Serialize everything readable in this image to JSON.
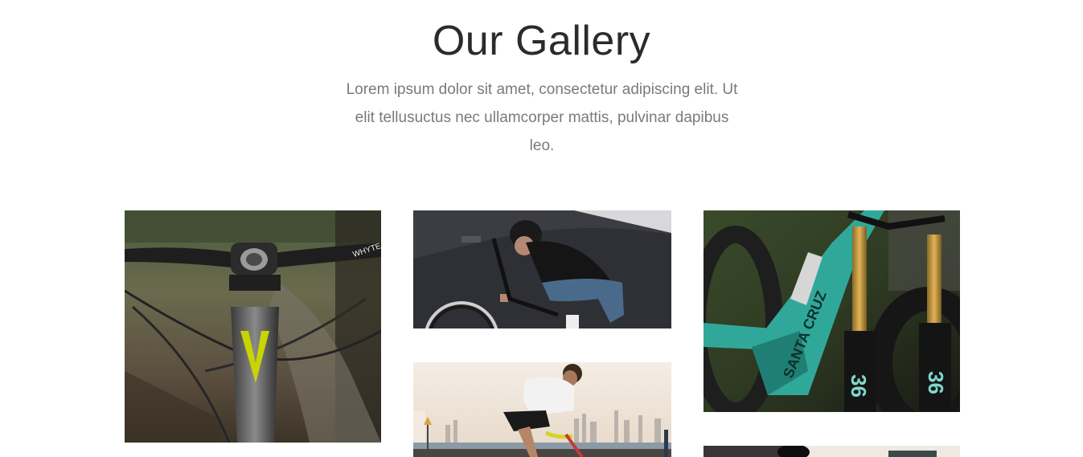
{
  "gallery": {
    "title": "Our Gallery",
    "description": "Lorem ipsum dolor sit amet, consectetur adipiscing elit. Ut elit tellusuctus nec ullamcorper mattis, pulvinar dapibus leo.",
    "images": [
      {
        "name": "bike-handlebar-photo",
        "brand_text": "WHYTE"
      },
      {
        "name": "bmx-rider-photo"
      },
      {
        "name": "cyclist-city-photo"
      },
      {
        "name": "teal-mountain-bike-photo",
        "frame_text": "SANTA CRUZ",
        "fork_text": "36"
      },
      {
        "name": "partial-photo-bottom"
      }
    ]
  }
}
